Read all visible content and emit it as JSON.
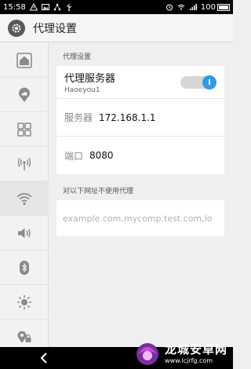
{
  "status_bar": {
    "time": "15:58",
    "battery": "100"
  },
  "header": {
    "title": "代理设置"
  },
  "sidebar": {
    "items": [
      {
        "icon": "home-icon"
      },
      {
        "icon": "location-cloud-icon"
      },
      {
        "icon": "apps-grid-icon"
      },
      {
        "icon": "wireless-signal-icon"
      },
      {
        "icon": "wifi-icon",
        "active": true
      },
      {
        "icon": "volume-icon"
      },
      {
        "icon": "bluetooth-icon"
      },
      {
        "icon": "brightness-icon"
      },
      {
        "icon": "location-lock-icon"
      }
    ]
  },
  "proxy": {
    "section_label": "代理设置",
    "proxy_server_label": "代理服务器",
    "network_name": "Haoeyou1",
    "toggle_on": true,
    "server_label": "服务器",
    "server_value": "172.168.1.1",
    "port_label": "端口",
    "port_value": "8080"
  },
  "bypass": {
    "section_label": "对以下网址不使用代理",
    "placeholder": "example.com,mycomp.test.com,lo"
  },
  "watermark": {
    "title": "龙城安卓网",
    "url": "www.lcjrfg.com"
  },
  "colors": {
    "accent": "#2f9be5",
    "statusbar": "#000000"
  }
}
